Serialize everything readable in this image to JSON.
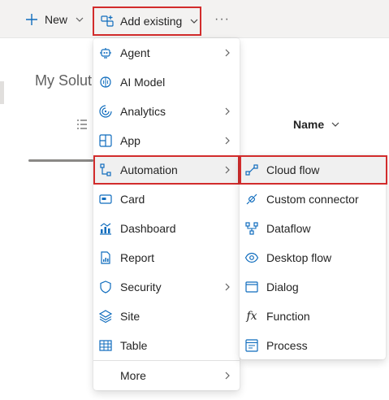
{
  "toolbar": {
    "new_label": "New",
    "add_existing_label": "Add existing",
    "more_label": "···"
  },
  "background": {
    "title": "My Solut",
    "name_column": "Name"
  },
  "menu": {
    "items": [
      {
        "label": "Agent",
        "icon": "agent-icon",
        "has_submenu": true
      },
      {
        "label": "AI Model",
        "icon": "ai-model-icon",
        "has_submenu": false
      },
      {
        "label": "Analytics",
        "icon": "analytics-icon",
        "has_submenu": true
      },
      {
        "label": "App",
        "icon": "app-icon",
        "has_submenu": true
      },
      {
        "label": "Automation",
        "icon": "automation-icon",
        "has_submenu": true,
        "selected": true
      },
      {
        "label": "Card",
        "icon": "card-icon",
        "has_submenu": false
      },
      {
        "label": "Dashboard",
        "icon": "dashboard-icon",
        "has_submenu": false
      },
      {
        "label": "Report",
        "icon": "report-icon",
        "has_submenu": false
      },
      {
        "label": "Security",
        "icon": "security-icon",
        "has_submenu": true
      },
      {
        "label": "Site",
        "icon": "site-icon",
        "has_submenu": false
      },
      {
        "label": "Table",
        "icon": "table-icon",
        "has_submenu": false
      },
      {
        "label": "More",
        "icon": "",
        "has_submenu": true
      }
    ]
  },
  "submenu": {
    "items": [
      {
        "label": "Cloud flow",
        "icon": "cloud-flow-icon",
        "highlighted": true
      },
      {
        "label": "Custom connector",
        "icon": "custom-connector-icon"
      },
      {
        "label": "Dataflow",
        "icon": "dataflow-icon"
      },
      {
        "label": "Desktop flow",
        "icon": "desktop-flow-icon"
      },
      {
        "label": "Dialog",
        "icon": "dialog-icon"
      },
      {
        "label": "Function",
        "icon": "function-icon",
        "glyph": "fx"
      },
      {
        "label": "Process",
        "icon": "process-icon"
      }
    ]
  },
  "colors": {
    "accent": "#0f6cbd",
    "highlight_border": "#d22c2c",
    "toolbar_bg": "#f3f2f1"
  }
}
